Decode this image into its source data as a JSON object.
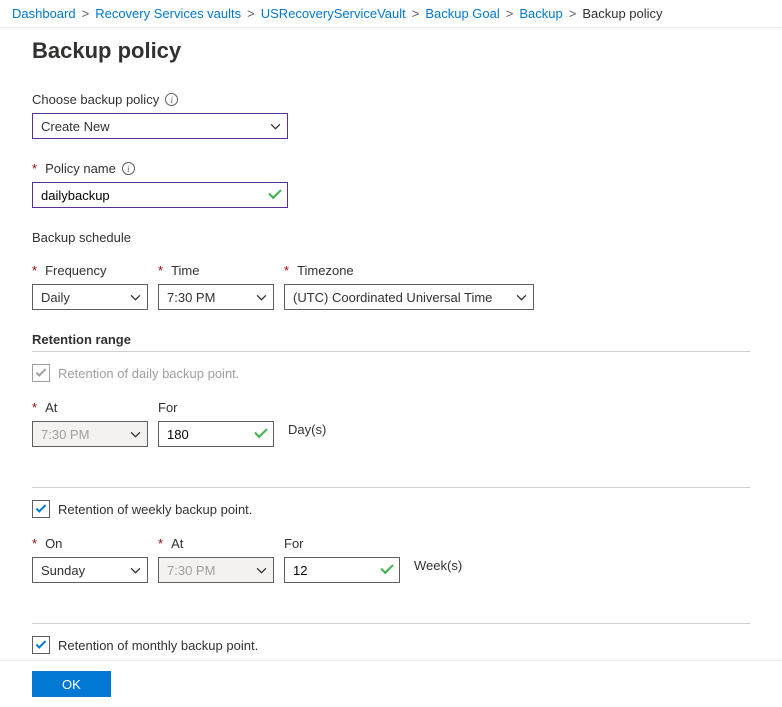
{
  "breadcrumb": {
    "items": [
      "Dashboard",
      "Recovery Services vaults",
      "USRecoveryServiceVault",
      "Backup Goal",
      "Backup"
    ],
    "current": "Backup policy"
  },
  "page_title": "Backup policy",
  "policy_select": {
    "label": "Choose backup policy",
    "value": "Create New"
  },
  "policy_name": {
    "label": "Policy name",
    "value": "dailybackup"
  },
  "schedule_heading": "Backup schedule",
  "schedule": {
    "frequency": {
      "label": "Frequency",
      "value": "Daily"
    },
    "time": {
      "label": "Time",
      "value": "7:30 PM"
    },
    "timezone": {
      "label": "Timezone",
      "value": "(UTC) Coordinated Universal Time"
    }
  },
  "retention_heading": "Retention range",
  "daily": {
    "checkbox_label": "Retention of daily backup point.",
    "at_label": "At",
    "at_value": "7:30 PM",
    "for_label": "For",
    "for_value": "180",
    "unit": "Day(s)"
  },
  "weekly": {
    "checkbox_label": "Retention of weekly backup point.",
    "on_label": "On",
    "on_value": "Sunday",
    "at_label": "At",
    "at_value": "7:30 PM",
    "for_label": "For",
    "for_value": "12",
    "unit": "Week(s)"
  },
  "monthly": {
    "checkbox_label": "Retention of monthly backup point."
  },
  "footer": {
    "ok": "OK"
  }
}
